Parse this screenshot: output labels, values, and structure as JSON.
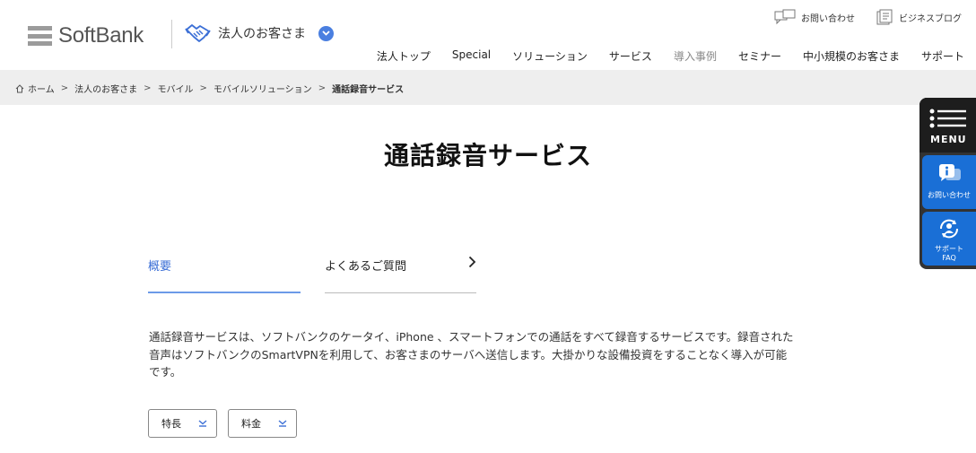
{
  "brand": {
    "logo_text": "SoftBank",
    "business_label": "法人のお客さま"
  },
  "utility": {
    "contact": "お問い合わせ",
    "blog": "ビジネスブログ"
  },
  "nav": [
    {
      "label": "法人トップ",
      "muted": false
    },
    {
      "label": "Special",
      "muted": false
    },
    {
      "label": "ソリューション",
      "muted": false
    },
    {
      "label": "サービス",
      "muted": false
    },
    {
      "label": "導入事例",
      "muted": true
    },
    {
      "label": "セミナー",
      "muted": false
    },
    {
      "label": "中小規模のお客さま",
      "muted": false
    },
    {
      "label": "サポート",
      "muted": false
    }
  ],
  "breadcrumb": {
    "items": [
      "ホーム",
      "法人のお客さま",
      "モバイル",
      "モバイルソリューション"
    ],
    "current": "通話録音サービス",
    "separator": ">"
  },
  "page": {
    "title": "通話録音サービス",
    "tabs": {
      "overview": "概要",
      "faq": "よくあるご質問"
    },
    "description_lines": [
      "通話録音サービスは、ソフトバンクのケータイ、iPhone 、スマートフォンでの通話をすべて録音するサービスです。録音された",
      "音声はソフトバンクのSmartVPNを利用して、お客さまのサーバへ送信します。大掛かりな設備投資をすることなく導入が可能",
      "です。"
    ],
    "anchors": {
      "features": "特長",
      "fees": "料金"
    }
  },
  "sidebar": {
    "menu_label": "MENU",
    "contact_label": "お問い合わせ",
    "faq_label_1": "サポート",
    "faq_label_2": "FAQ"
  },
  "colors": {
    "accent": "#3b6fd6",
    "sidebar_blue": "#1a6fd6",
    "crumb_bg": "#eeeeee"
  }
}
